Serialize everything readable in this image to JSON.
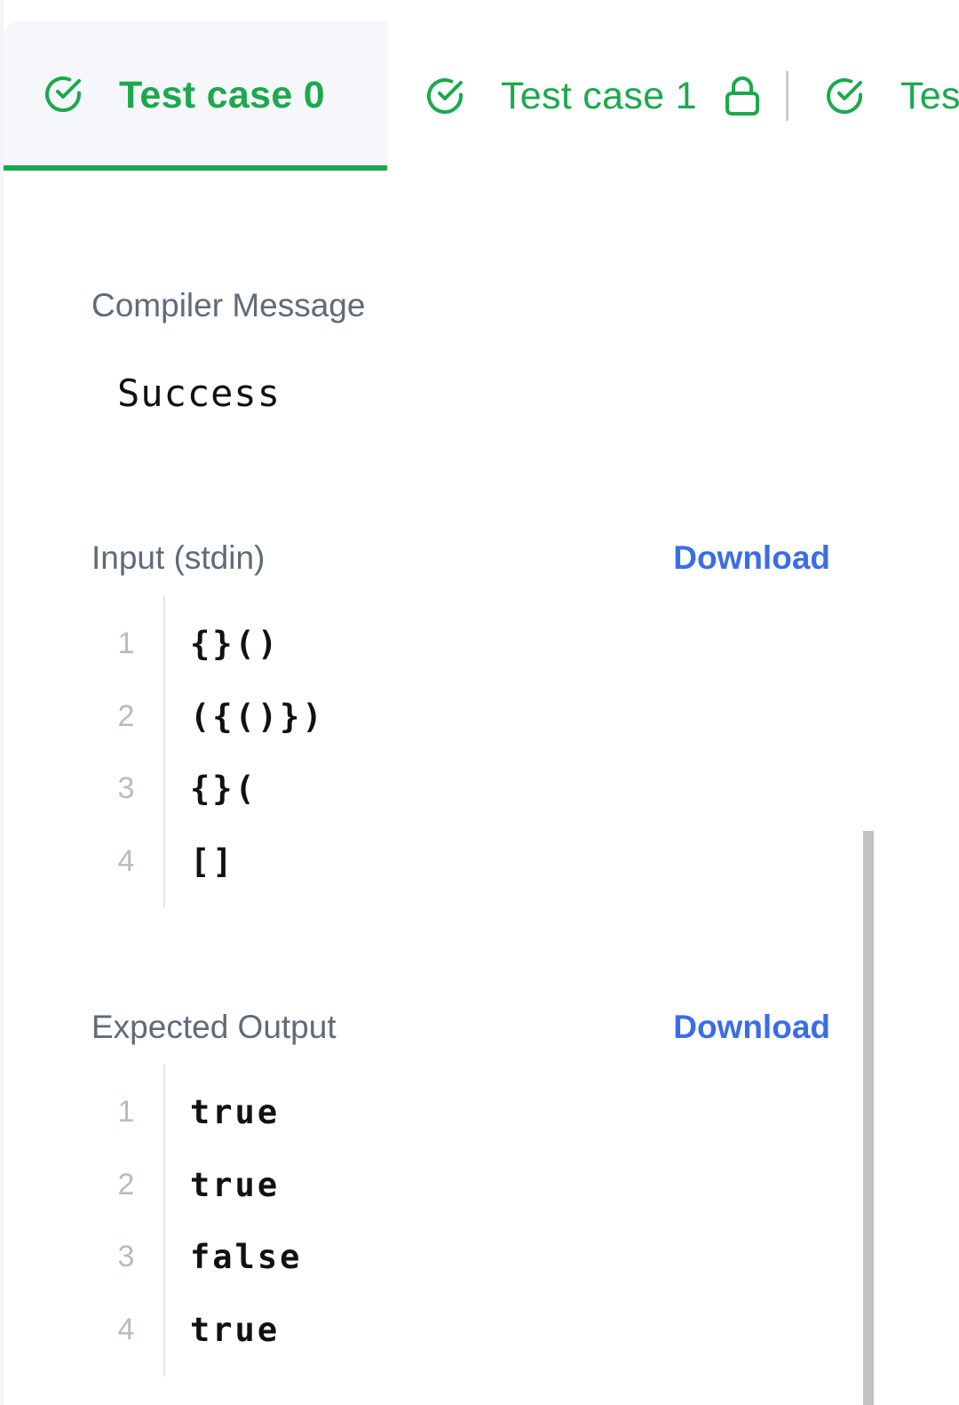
{
  "tabs": [
    {
      "label": "Test case 0",
      "status_icon": "check-circle-icon",
      "active": true
    },
    {
      "label": "Test case 1",
      "status_icon": "check-circle-icon",
      "locked": true,
      "lock_icon": "lock-icon"
    },
    {
      "label": "Tes",
      "status_icon": "check-circle-icon"
    }
  ],
  "compiler": {
    "label": "Compiler Message",
    "value": "Success"
  },
  "input": {
    "label": "Input (stdin)",
    "download_label": "Download",
    "lines": [
      {
        "num": "1",
        "text": "{}()"
      },
      {
        "num": "2",
        "text": "({()})"
      },
      {
        "num": "3",
        "text": "{}("
      },
      {
        "num": "4",
        "text": "[]"
      }
    ]
  },
  "expected": {
    "label": "Expected Output",
    "download_label": "Download",
    "lines": [
      {
        "num": "1",
        "text": "true"
      },
      {
        "num": "2",
        "text": "true"
      },
      {
        "num": "3",
        "text": "false"
      },
      {
        "num": "4",
        "text": "true"
      }
    ]
  },
  "colors": {
    "accent_green": "#1ba94c",
    "link_blue": "#3a6ee8",
    "label_gray": "#5f6b78",
    "line_number_gray": "#b4bcc4"
  }
}
